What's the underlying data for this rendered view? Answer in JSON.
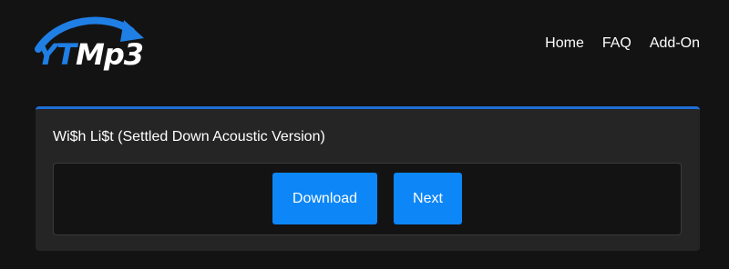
{
  "logo": {
    "part_yt": "YT",
    "part_mp3": "Mp3"
  },
  "nav": {
    "items": [
      "Home",
      "FAQ",
      "Add-On"
    ]
  },
  "card": {
    "title": "Wi$h Li$t (Settled Down Acoustic Version)",
    "download_label": "Download",
    "next_label": "Next"
  },
  "colors": {
    "background": "#141314",
    "card": "#252526",
    "accent": "#1e6fd6",
    "button": "#0d86f7",
    "text": "#ffffff"
  },
  "icons": {
    "logo_arrow": "curved-arrow-icon"
  }
}
